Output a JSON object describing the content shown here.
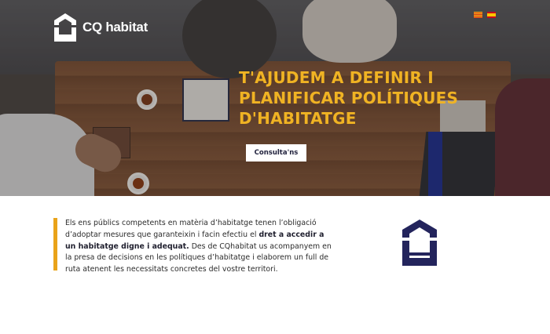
{
  "brand": {
    "name": "CQ habitat"
  },
  "languages": [
    {
      "code": "ca",
      "flag": "catalan-flag"
    },
    {
      "code": "es",
      "flag": "spanish-flag"
    }
  ],
  "hero": {
    "title_lines": [
      "T'AJUDEM A DEFINIR I",
      "PLANIFICAR POLÍTIQUES",
      "D'HABITATGE"
    ],
    "cta_label": "Consulta'ns",
    "accent_color": "#f0b323"
  },
  "intro": {
    "text_before": "Els ens públics competents en matèria d’habitatge tenen l’obligació d’adoptar mesures que garanteixin i facin efectiu el ",
    "text_bold": "dret a accedir a un habitatge digne i adequat.",
    "text_after": " Des de CQhabitat us acompanyem en la presa de decisions en les polítiques d’habitatge i elaborem un full de ruta atenent les necessitats concretes del vostre territori.",
    "bar_color": "#e9a31a",
    "emblem_color": "#23245c"
  }
}
